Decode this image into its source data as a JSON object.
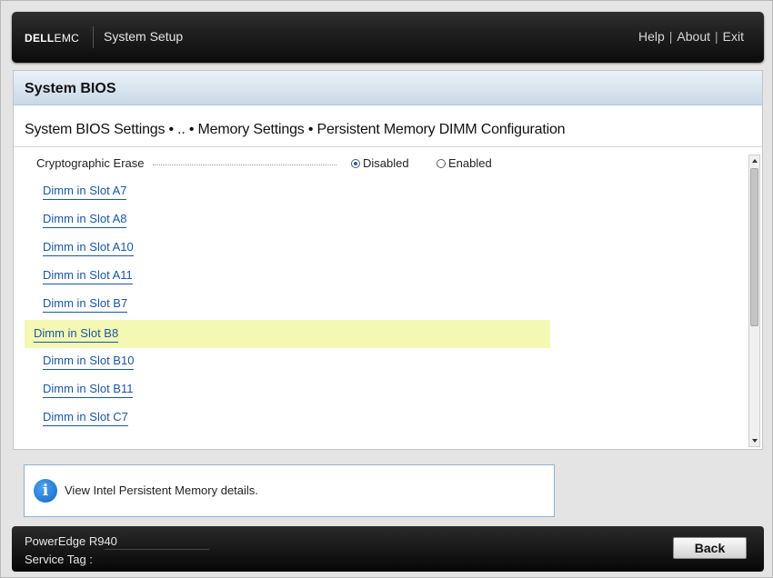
{
  "header": {
    "logo": {
      "dell": "DELL",
      "emc": "EMC"
    },
    "app_title": "System Setup",
    "links": [
      "Help",
      "About",
      "Exit"
    ],
    "link_separator": "|"
  },
  "section": {
    "title": "System BIOS",
    "breadcrumb": "System BIOS Settings • .. • Memory Settings • Persistent Memory DIMM Configuration"
  },
  "setting": {
    "label": "Cryptographic Erase",
    "options": [
      {
        "label": "Disabled",
        "selected": true
      },
      {
        "label": "Enabled",
        "selected": false
      }
    ]
  },
  "dimms": [
    "Dimm in Slot A7",
    "Dimm in Slot A8",
    "Dimm in Slot A10",
    "Dimm in Slot A11",
    "Dimm in Slot B7",
    "Dimm in Slot B8",
    "Dimm in Slot B10",
    "Dimm in Slot B11",
    "Dimm in Slot C7"
  ],
  "highlighted_dimm": "Dimm in Slot B8",
  "help": {
    "text": "View Intel Persistent Memory details."
  },
  "footer": {
    "model": "PowerEdge R940",
    "service_tag_label": "Service Tag :",
    "back_label": "Back"
  },
  "colors": {
    "link": "#1a56a6",
    "highlight": "#f4f8b3",
    "header_gradient_top": "#e8f1f8",
    "header_gradient_bottom": "#cad9e6"
  }
}
